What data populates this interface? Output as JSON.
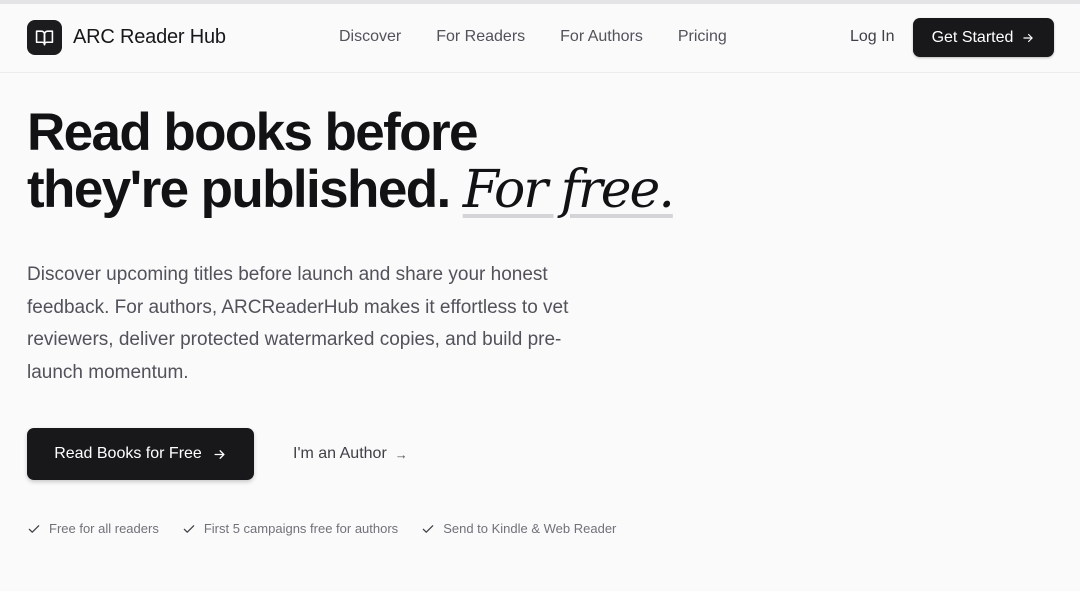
{
  "brand": {
    "name": "ARC Reader Hub",
    "logo_icon": "book-open-icon"
  },
  "nav": {
    "items": [
      {
        "label": "Discover"
      },
      {
        "label": "For Readers"
      },
      {
        "label": "For Authors"
      },
      {
        "label": "Pricing"
      }
    ],
    "login_label": "Log In",
    "get_started_label": "Get Started"
  },
  "hero": {
    "title_line1": "Read books before",
    "title_line2": "they're published.",
    "title_accent": "For free.",
    "description": "Discover upcoming titles before launch and share your honest feedback. For authors, ARCReaderHub makes it effortless to vet reviewers, deliver protected watermarked copies, and build pre-launch momentum.",
    "primary_cta": "Read Books for Free",
    "secondary_cta": "I'm an Author",
    "secondary_arrow": "→"
  },
  "features": [
    {
      "label": "Free for all readers",
      "icon": "check-icon"
    },
    {
      "label": "First 5 campaigns free for authors",
      "icon": "check-icon"
    },
    {
      "label": "Send to Kindle & Web Reader",
      "icon": "check-icon"
    }
  ],
  "colors": {
    "primary": "#18181b",
    "background": "#fafafa",
    "muted_text": "#52525b",
    "accent_underline": "#d4d4d8"
  }
}
